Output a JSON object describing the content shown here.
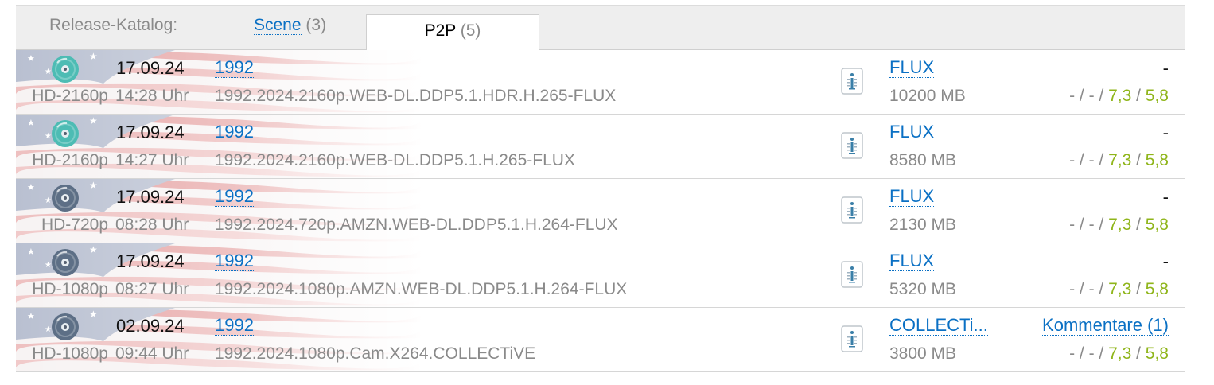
{
  "tabs": {
    "label": "Release-Katalog:",
    "items": [
      {
        "name": "Scene",
        "count": "(3)"
      },
      {
        "name": "P2P",
        "count": "(5)"
      }
    ]
  },
  "colors": {
    "link": "#0a70c4",
    "muted": "#8a8a8a",
    "rating": "#8fb51a"
  },
  "icons": {
    "row_icon": "disc-icon",
    "nfo": "nfo-info-icon",
    "background": "us-flag-background"
  },
  "rows": [
    {
      "date": "17.09.24",
      "time": "14:28 Uhr",
      "res": "HD-2160p",
      "title": "1992",
      "release": "1992.2024.2160p.WEB-DL.DDP5.1.HDR.H.265-FLUX",
      "group": "FLUX",
      "size": "10200 MB",
      "comments": "-",
      "rating_prefix": "- / - / ",
      "rating_a": "7,3",
      "rating_sep": " / ",
      "rating_b": "5,8",
      "disc": "teal"
    },
    {
      "date": "17.09.24",
      "time": "14:27 Uhr",
      "res": "HD-2160p",
      "title": "1992",
      "release": "1992.2024.2160p.WEB-DL.DDP5.1.H.265-FLUX",
      "group": "FLUX",
      "size": "8580 MB",
      "comments": "-",
      "rating_prefix": "- / - / ",
      "rating_a": "7,3",
      "rating_sep": " / ",
      "rating_b": "5,8",
      "disc": "teal"
    },
    {
      "date": "17.09.24",
      "time": "08:28 Uhr",
      "res": "HD-720p",
      "title": "1992",
      "release": "1992.2024.720p.AMZN.WEB-DL.DDP5.1.H.264-FLUX",
      "group": "FLUX",
      "size": "2130 MB",
      "comments": "-",
      "rating_prefix": "- / - / ",
      "rating_a": "7,3",
      "rating_sep": " / ",
      "rating_b": "5,8",
      "disc": "slate"
    },
    {
      "date": "17.09.24",
      "time": "08:27 Uhr",
      "res": "HD-1080p",
      "title": "1992",
      "release": "1992.2024.1080p.AMZN.WEB-DL.DDP5.1.H.264-FLUX",
      "group": "FLUX",
      "size": "5320 MB",
      "comments": "-",
      "rating_prefix": "- / - / ",
      "rating_a": "7,3",
      "rating_sep": " / ",
      "rating_b": "5,8",
      "disc": "slate"
    },
    {
      "date": "02.09.24",
      "time": "09:44 Uhr",
      "res": "HD-1080p",
      "title": "1992",
      "release": "1992.2024.1080p.Cam.X264.COLLECTiVE",
      "group": "COLLECTi...",
      "size": "3800 MB",
      "comments": "Kommentare (1)",
      "rating_prefix": "- / - / ",
      "rating_a": "7,3",
      "rating_sep": " / ",
      "rating_b": "5,8",
      "disc": "slate"
    }
  ]
}
